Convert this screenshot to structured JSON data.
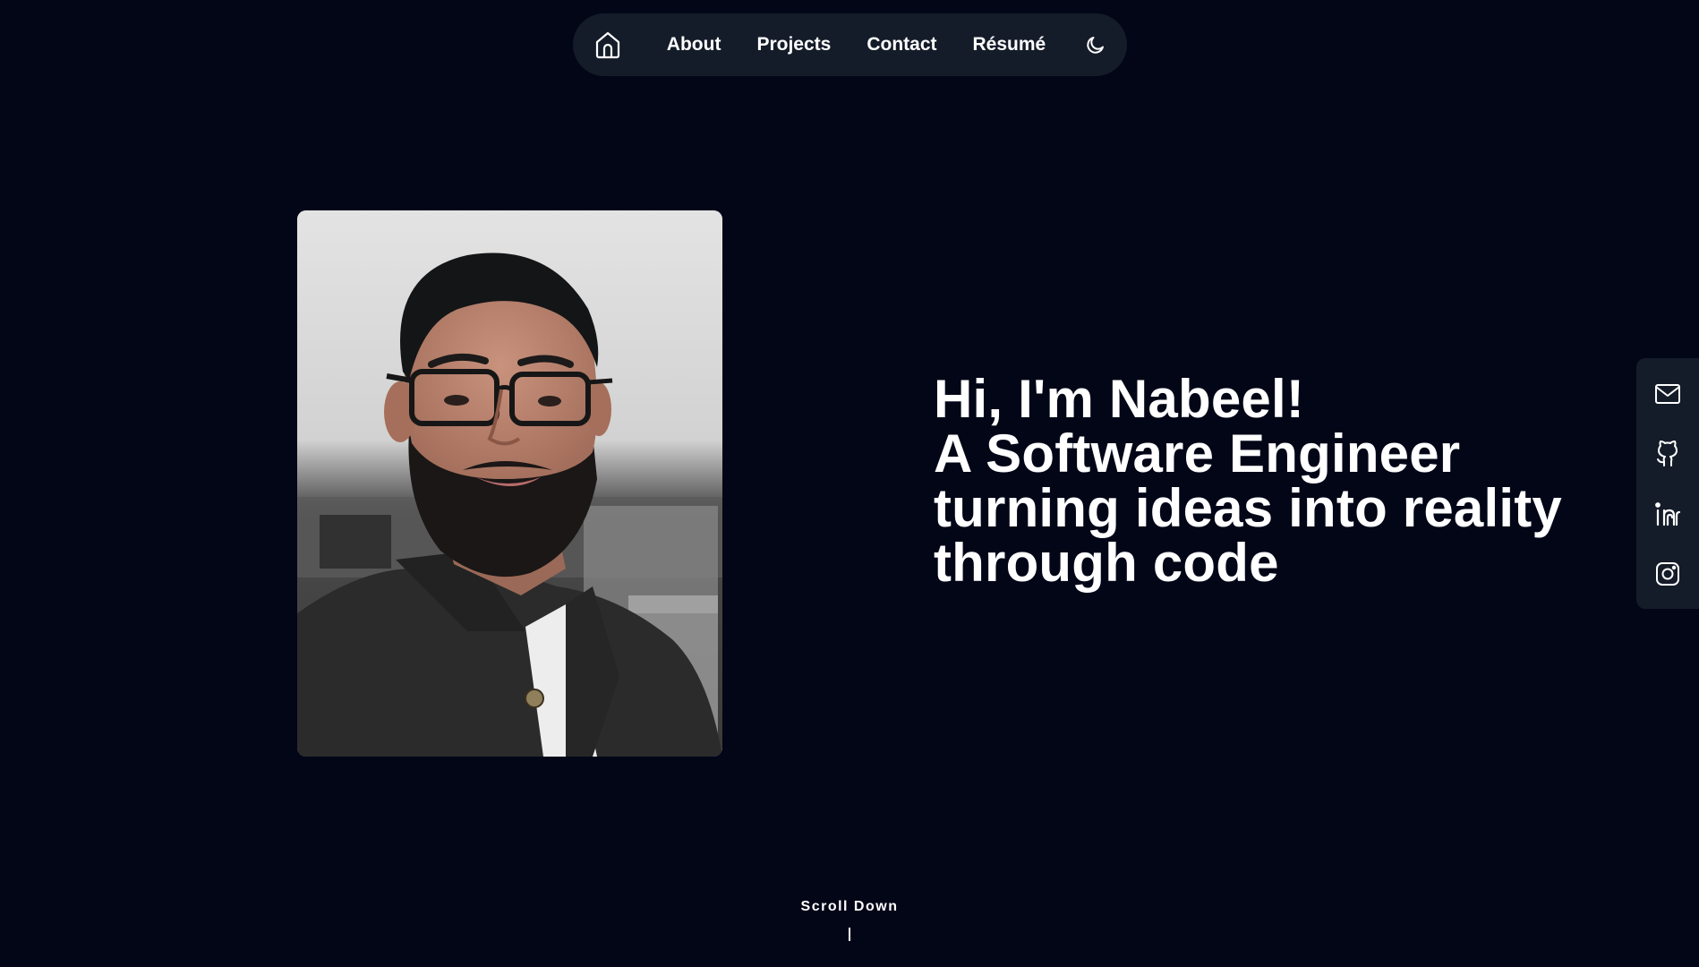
{
  "nav": {
    "home_icon": "home-icon",
    "links": [
      "About",
      "Projects",
      "Contact",
      "Résumé"
    ],
    "theme_icon": "moon-icon"
  },
  "hero": {
    "lines": [
      "Hi, I'm Nabeel!",
      "A Software Engineer",
      "turning ideas into reality",
      "through code"
    ]
  },
  "social": {
    "icons": [
      "mail-icon",
      "github-icon",
      "linkedin-icon",
      "instagram-icon"
    ]
  },
  "scroll": {
    "label": "Scroll Down"
  },
  "colors": {
    "background": "#020617",
    "surface": "#151c29",
    "text": "#ffffff"
  }
}
